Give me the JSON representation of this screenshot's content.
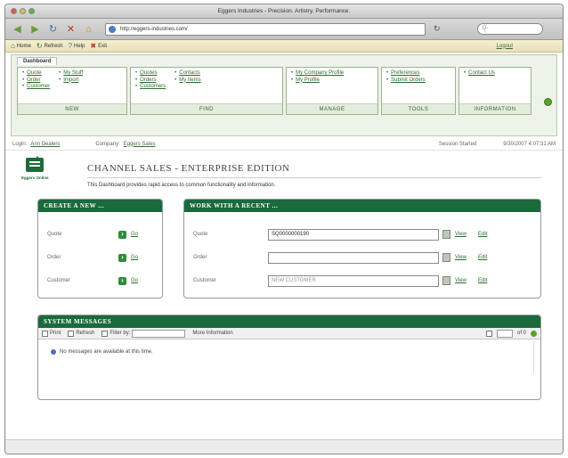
{
  "window": {
    "title": "Eggers Industries - Precision. Artistry. Performance."
  },
  "nav": {
    "url": "http://eggers-industries.com/",
    "search_placeholder": "Q-"
  },
  "app_toolbar": {
    "items": [
      "Home",
      "Refresh",
      "Help",
      "Exit"
    ],
    "logout": "Logout"
  },
  "dashboard": {
    "tab": "Dashboard",
    "groups": [
      {
        "label": "NEW",
        "col1": [
          "Quote",
          "Order",
          "Customer"
        ],
        "col2": [
          "My Stuff",
          "Import"
        ]
      },
      {
        "label": "FIND",
        "col1": [
          "Quotes",
          "Orders",
          "Customers"
        ],
        "col2": [
          "Contacts",
          "My Items"
        ]
      },
      {
        "label": "MANAGE",
        "col1": [
          "My Company Profile",
          "My Profile"
        ],
        "col2": []
      },
      {
        "label": "TOOLS",
        "col1": [
          "Preferences",
          "Submit Orders"
        ],
        "col2": []
      },
      {
        "label": "INFORMATION",
        "col1": [
          "Contact Us"
        ],
        "col2": []
      }
    ]
  },
  "status": {
    "login_label": "Login:",
    "login_value": "Ann Dealers",
    "company_label": "Company:",
    "company_value": "Eggers Sales",
    "session": "Session Started",
    "datetime": "9/30/2007 4:07:31 AM"
  },
  "header": {
    "logo_text": "Eggers Online",
    "title": "CHANNEL SALES - ENTERPRISE EDITION",
    "description": "This Dashboard provides rapid access to common functionality and information."
  },
  "create_new": {
    "title": "CREATE A NEW ...",
    "rows": [
      {
        "label": "Quote",
        "go": "Go"
      },
      {
        "label": "Order",
        "go": "Go"
      },
      {
        "label": "Customer",
        "go": "Go"
      }
    ]
  },
  "work_recent": {
    "title": "WORK WITH A RECENT ...",
    "rows": [
      {
        "label": "Quote",
        "value": "SQ0000000190",
        "placeholder": "",
        "view": "View",
        "edit": "Edit"
      },
      {
        "label": "Order",
        "value": "",
        "placeholder": "",
        "view": "View",
        "edit": "Edit"
      },
      {
        "label": "Customer",
        "value": "",
        "placeholder": "NEW CUSTOMER",
        "view": "View",
        "edit": "Edit"
      }
    ]
  },
  "system_messages": {
    "title": "SYSTEM MESSAGES",
    "toolbar": [
      "Print",
      "Refresh",
      "Filter by:",
      "More Information"
    ],
    "page_of": "of 0",
    "empty_message": "No messages are available at this time."
  }
}
